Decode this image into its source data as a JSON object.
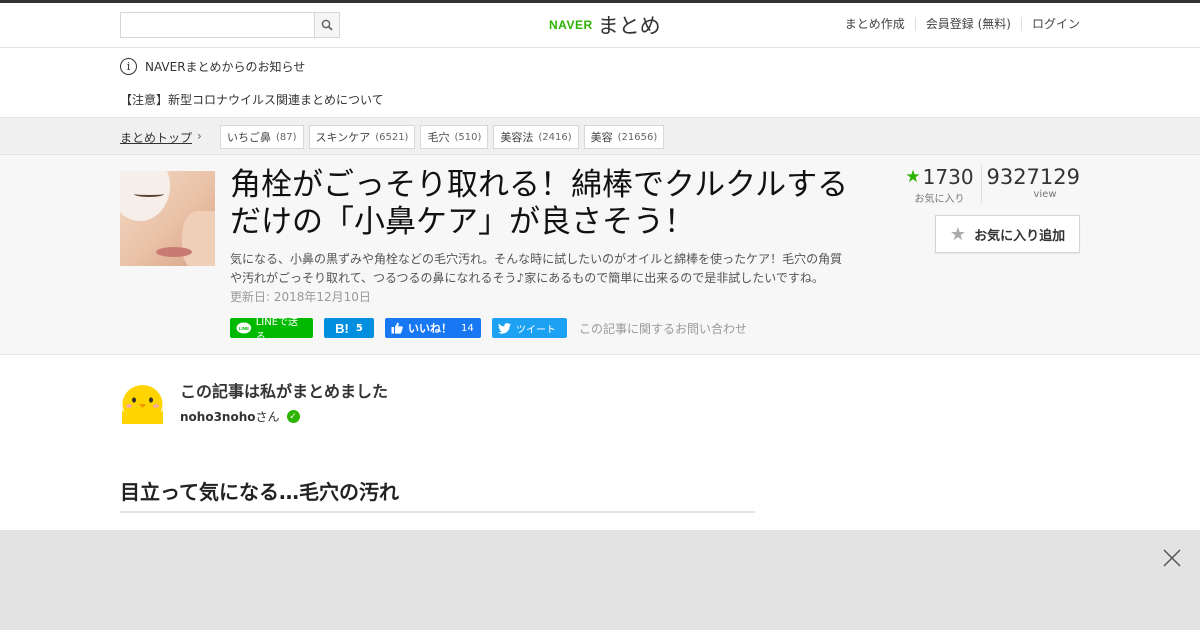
{
  "header": {
    "search_placeholder": "",
    "logo_brand": "NAVER",
    "logo_name": "まとめ",
    "links": [
      "まとめ作成",
      "会員登録 (無料)",
      "ログイン"
    ]
  },
  "notice": {
    "heading": "NAVERまとめからのお知らせ",
    "link": "【注意】新型コロナウイルス関連まとめについて"
  },
  "breadcrumb": {
    "top": "まとめトップ",
    "tags": [
      {
        "label": "いちご鼻",
        "count": "(87)"
      },
      {
        "label": "スキンケア",
        "count": "(6521)"
      },
      {
        "label": "毛穴",
        "count": "(510)"
      },
      {
        "label": "美容法",
        "count": "(2416)"
      },
      {
        "label": "美容",
        "count": "(21656)"
      }
    ]
  },
  "article": {
    "title": "角栓がごっそり取れる！綿棒でクルクルするだけの「小鼻ケア」が良さそう！",
    "description": "気になる、小鼻の黒ずみや角栓などの毛穴汚れ。そんな時に試したいのがオイルと綿棒を使ったケア！毛穴の角質や汚れがごっそり取れて、つるつるの鼻になれるそう♪家にあるもので簡単に出来るので是非試したいですね。",
    "updated": "更新日: 2018年12月10日",
    "favorites": "1730",
    "favorites_label": "お気に入り",
    "views": "9327129",
    "views_label": "view",
    "fav_button": "お気に入り追加"
  },
  "share": {
    "line": "LINEで送る",
    "hatena_count": "5",
    "fb_label": "いいね！",
    "fb_count": "14",
    "tweet": "ツイート",
    "contact": "この記事に関するお問い合わせ"
  },
  "author": {
    "heading": "この記事は私がまとめました",
    "name": "noho3noho",
    "suffix": "さん"
  },
  "section": {
    "heading": "目立って気になる…毛穴の汚れ"
  },
  "colors": {
    "brand_green": "#2db400",
    "line_green": "#00b900",
    "hatena_blue": "#008fde",
    "facebook_blue": "#1877f2",
    "twitter_blue": "#1da1f2"
  }
}
